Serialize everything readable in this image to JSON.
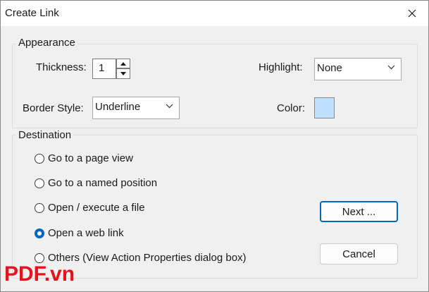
{
  "window": {
    "title": "Create Link"
  },
  "appearance": {
    "legend": "Appearance",
    "thickness_label": "Thickness:",
    "thickness_value": "1",
    "highlight_label": "Highlight:",
    "highlight_value": "None",
    "border_style_label": "Border Style:",
    "border_style_value": "Underline",
    "color_label": "Color:",
    "color_value": "#bfe0ff"
  },
  "destination": {
    "legend": "Destination",
    "options": [
      {
        "label": "Go to a page view",
        "checked": false
      },
      {
        "label": "Go to a named position",
        "checked": false
      },
      {
        "label": "Open / execute a file",
        "checked": false
      },
      {
        "label": "Open a web link",
        "checked": true
      },
      {
        "label": "Others (View Action Properties dialog box)",
        "checked": false
      }
    ]
  },
  "buttons": {
    "next": "Next ...",
    "cancel": "Cancel"
  },
  "watermark": {
    "brand": "PDF",
    "suffix": ".vn"
  }
}
